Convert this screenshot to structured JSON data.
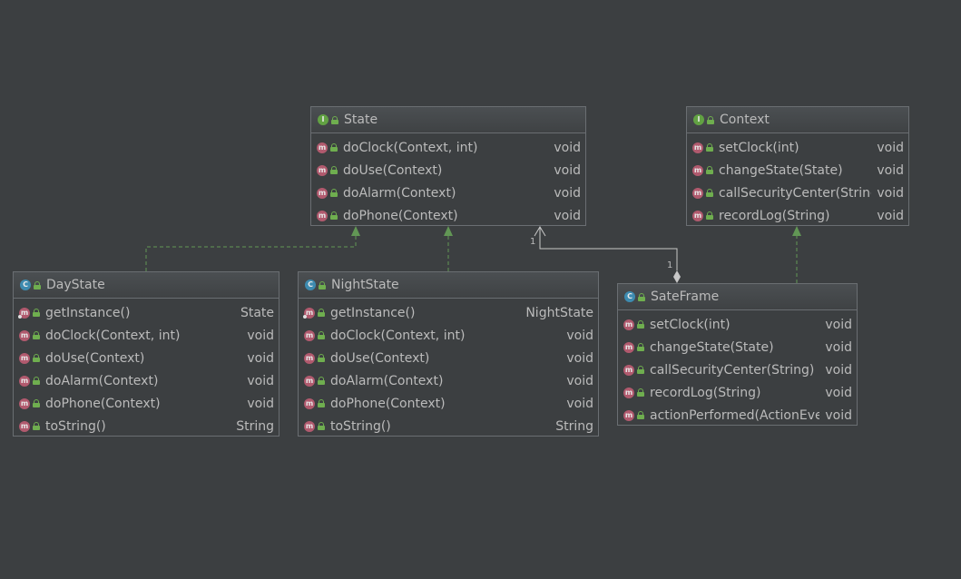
{
  "colors": {
    "background": "#3c3f41",
    "border": "#6a6e72",
    "text": "#bbbbbb",
    "realization_edge": "#629755",
    "association_edge": "#c8c8c8",
    "interface_icon": "#62a243",
    "class_icon": "#3d8bb0",
    "method_icon": "#b15a6e"
  },
  "nodes": [
    {
      "id": "state",
      "kind": "I",
      "icon": "interface-icon",
      "name": "State",
      "members": [
        {
          "name": "doClock(Context, int)",
          "type": "void"
        },
        {
          "name": "doUse(Context)",
          "type": "void"
        },
        {
          "name": "doAlarm(Context)",
          "type": "void"
        },
        {
          "name": "doPhone(Context)",
          "type": "void"
        }
      ]
    },
    {
      "id": "context",
      "kind": "I",
      "icon": "interface-icon",
      "name": "Context",
      "members": [
        {
          "name": "setClock(int)",
          "type": "void"
        },
        {
          "name": "changeState(State)",
          "type": "void"
        },
        {
          "name": "callSecurityCenter(String)",
          "type": "void"
        },
        {
          "name": "recordLog(String)",
          "type": "void"
        }
      ]
    },
    {
      "id": "daystate",
      "kind": "C",
      "icon": "class-icon",
      "name": "DayState",
      "members": [
        {
          "name": "getInstance()",
          "type": "State",
          "static": true
        },
        {
          "name": "doClock(Context, int)",
          "type": "void"
        },
        {
          "name": "doUse(Context)",
          "type": "void"
        },
        {
          "name": "doAlarm(Context)",
          "type": "void"
        },
        {
          "name": "doPhone(Context)",
          "type": "void"
        },
        {
          "name": "toString()",
          "type": "String"
        }
      ]
    },
    {
      "id": "nightstate",
      "kind": "C",
      "icon": "class-icon",
      "name": "NightState",
      "members": [
        {
          "name": "getInstance()",
          "type": "NightState",
          "static": true
        },
        {
          "name": "doClock(Context, int)",
          "type": "void"
        },
        {
          "name": "doUse(Context)",
          "type": "void"
        },
        {
          "name": "doAlarm(Context)",
          "type": "void"
        },
        {
          "name": "doPhone(Context)",
          "type": "void"
        },
        {
          "name": "toString()",
          "type": "String"
        }
      ]
    },
    {
      "id": "sateframe",
      "kind": "C",
      "icon": "class-icon",
      "name": "SateFrame",
      "members": [
        {
          "name": "setClock(int)",
          "type": "void"
        },
        {
          "name": "changeState(State)",
          "type": "void"
        },
        {
          "name": "callSecurityCenter(String)",
          "type": "void"
        },
        {
          "name": "recordLog(String)",
          "type": "void"
        },
        {
          "name": "actionPerformed(ActionEvent)",
          "type": "void"
        }
      ]
    }
  ],
  "edges": [
    {
      "from": "daystate",
      "to": "state",
      "type": "realization"
    },
    {
      "from": "nightstate",
      "to": "state",
      "type": "realization"
    },
    {
      "from": "sateframe",
      "to": "context",
      "type": "realization"
    },
    {
      "from": "sateframe",
      "to": "state",
      "type": "association",
      "source_end": "aggregation-diamond",
      "target_end": "open-arrow",
      "source_multiplicity": "1",
      "target_multiplicity": "1"
    }
  ]
}
